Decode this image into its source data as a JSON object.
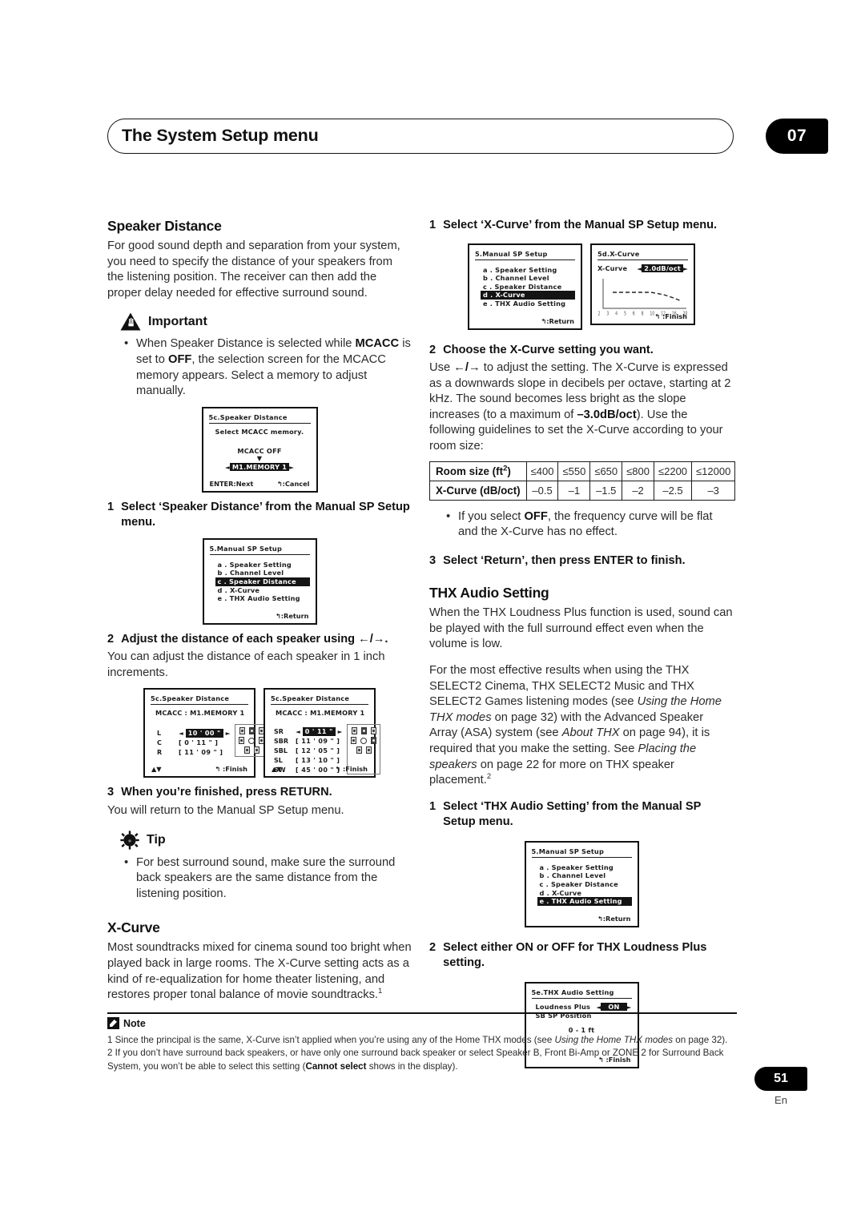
{
  "header": {
    "title": "The System Setup menu",
    "chapter": "07"
  },
  "left": {
    "speaker_distance": {
      "heading": "Speaker Distance",
      "intro": "For good sound depth and separation from your system, you need to specify the distance of your speakers from the listening position. The receiver can then add the proper delay needed for effective surround sound.",
      "important_label": "Important",
      "important_bullet_1": "When Speaker Distance is selected while <b>MCACC</b> is set to <b>OFF</b>, the selection screen for the MCACC memory appears. Select a memory to adjust manually.",
      "step1_num": "1",
      "step1_text": "Select ‘Speaker Distance’ from the Manual SP Setup menu.",
      "step2_num": "2",
      "step2_text": "Adjust the distance of each speaker using ←/→.",
      "step2_body": "You can adjust the distance of each speaker in 1 inch increments.",
      "step3_num": "3",
      "step3_text": "When you’re finished, press RETURN.",
      "step3_body": "You will return to the Manual SP Setup menu.",
      "tip_label": "Tip",
      "tip_bullet_1": "For best surround sound, make sure the surround back speakers are the same distance from the listening position."
    },
    "xcurve": {
      "heading": "X-Curve",
      "body": "Most soundtracks mixed for cinema sound too bright when played back in large rooms. The X-Curve setting acts as a kind of re-equalization for home theater listening, and restores proper tonal balance of movie soundtracks.<sup>1</sup>"
    }
  },
  "right": {
    "xcurve_steps": {
      "step1_num": "1",
      "step1_text": "Select ‘X-Curve’ from the Manual SP Setup menu.",
      "step2_num": "2",
      "step2_text": "Choose the X-Curve setting you want.",
      "step2_body": "Use <b>←/→</b> to adjust the setting. The X-Curve is expressed as a downwards slope in decibels per octave, starting at 2 kHz. The sound becomes less bright as the slope increases (to a maximum of <b>–3.0dB/oct</b>). Use the following guidelines to set the X-Curve according to your room size:",
      "bullet_off": "If you select <b>OFF</b>, the frequency curve will be flat and the X-Curve has no effect.",
      "step3_num": "3",
      "step3_text": "Select ‘Return’, then press ENTER to finish."
    },
    "thx": {
      "heading": "THX Audio Setting",
      "para1": "When the THX Loudness Plus function is used, sound can be played with the full surround effect even when the volume is low.",
      "para2": "For the most effective results when using the THX SELECT2 Cinema, THX SELECT2 Music and THX SELECT2 Games listening modes (see <i>Using the Home THX modes</i> on page 32) with the Advanced Speaker Array (ASA) system (see <i>About THX</i> on page 94), it is required that you make the setting. See <i>Placing the speakers</i> on page 22 for more on THX speaker placement.<sup>2</sup>",
      "step1_num": "1",
      "step1_text": "Select ‘THX Audio Setting’ from the Manual SP Setup menu.",
      "step2_num": "2",
      "step2_text": "Select either ON or OFF for THX Loudness Plus setting."
    }
  },
  "table": {
    "row_head_1": "Room size (ft²)",
    "row_head_2": "X-Curve (dB/oct)",
    "room_sizes": [
      "≤400",
      "≤550",
      "≤650",
      "≤800",
      "≤2200",
      "≤12000"
    ],
    "xcurve_values": [
      "–0.5",
      "–1",
      "–1.5",
      "–2",
      "–2.5",
      "–3"
    ]
  },
  "screens": {
    "mcacc_memory": {
      "title": "5c.Speaker  Distance",
      "prompt": "Select  MCACC  memory.",
      "off_label": "MCACC  OFF",
      "down_arrow": "▼",
      "left_arrow": "◄",
      "right_arrow": "►",
      "selected": "M1.MEMORY  1",
      "footer_left": "ENTER:Next",
      "footer_right": "↰:Cancel"
    },
    "manual_sp_setup_c": {
      "title": "5.Manual  SP  Setup",
      "items": [
        "a . Speaker  Setting",
        "b . Channel  Level",
        "c . Speaker  Distance",
        "d . X-Curve",
        "e . THX  Audio  Setting"
      ],
      "selected_index": 2,
      "footer": "↰:Return"
    },
    "manual_sp_setup_d": {
      "title": "5.Manual  SP  Setup",
      "items": [
        "a . Speaker  Setting",
        "b . Channel  Level",
        "c . Speaker  Distance",
        "d . X-Curve",
        "e . THX  Audio  Setting"
      ],
      "selected_index": 3,
      "footer": "↰:Return"
    },
    "manual_sp_setup_e": {
      "title": "5.Manual  SP  Setup",
      "items": [
        "a . Speaker  Setting",
        "b . Channel  Level",
        "c . Speaker  Distance",
        "d . X-Curve",
        "e . THX  Audio  Setting"
      ],
      "selected_index": 4,
      "footer": "↰:Return"
    },
    "distance_front": {
      "title": "5c.Speaker  Distance",
      "mcacc_line": "MCACC    : M1.MEMORY  1",
      "rows": [
        {
          "label": "L",
          "value": "10 ' 00 \"",
          "selected": true
        },
        {
          "label": "C",
          "value": "[  0 ' 11 \" ]",
          "selected": false
        },
        {
          "label": "R",
          "value": "[ 11 ' 09 \" ]",
          "selected": false
        }
      ],
      "footer_left": "▲▼",
      "footer_right": "↰ :Finish"
    },
    "distance_surround": {
      "title": "5c.Speaker  Distance",
      "mcacc_line": "MCACC    : M1.MEMORY  1",
      "rows": [
        {
          "label": "SR",
          "value": "0 ' 11 \"",
          "selected": true
        },
        {
          "label": "SBR",
          "value": "[ 11 ' 09 \" ]",
          "selected": false
        },
        {
          "label": "SBL",
          "value": "[ 12 ' 05 \" ]",
          "selected": false
        },
        {
          "label": "SL",
          "value": "[ 13 ' 10 \" ]",
          "selected": false
        },
        {
          "label": "SW",
          "value": "[ 45 ' 00 \" ]",
          "selected": false
        }
      ],
      "footer_left": "▲▼",
      "footer_right": "↰ :Finish"
    },
    "xcurve_screen": {
      "title": "5d.X-Curve",
      "param_label": "X-Curve",
      "left_arrow": "◄",
      "right_arrow": "►",
      "value": "2.0dB/oct",
      "tick_labels": [
        "2",
        "3",
        "4",
        "5",
        "6",
        "8",
        "10",
        "12",
        "16",
        "20"
      ],
      "footer": "↰ :Finish"
    },
    "thx_screen": {
      "title": "5e.THX  Audio  Setting",
      "row1_label": "Loudness  Plus",
      "left_arrow": "◄",
      "right_arrow": "►",
      "row1_value": "ON",
      "row2_label": "SB  SP  Position",
      "row2_value": "0 - 1  ft",
      "footer": "↰ :Finish"
    }
  },
  "notes": {
    "label": "Note",
    "note1": "1 Since the principal is the same, X-Curve isn’t applied when you’re using any of the Home THX modes (see <i>Using the Home THX modes</i> on page 32).",
    "note2": "2 If you don’t have surround back speakers, or have only one surround back speaker or select Speaker B, Front Bi-Amp or ZONE 2 for Surround Back System, you won’t be able to select this setting (<b>Cannot select</b> shows in the display)."
  },
  "footer": {
    "page_number": "51",
    "language": "En"
  }
}
